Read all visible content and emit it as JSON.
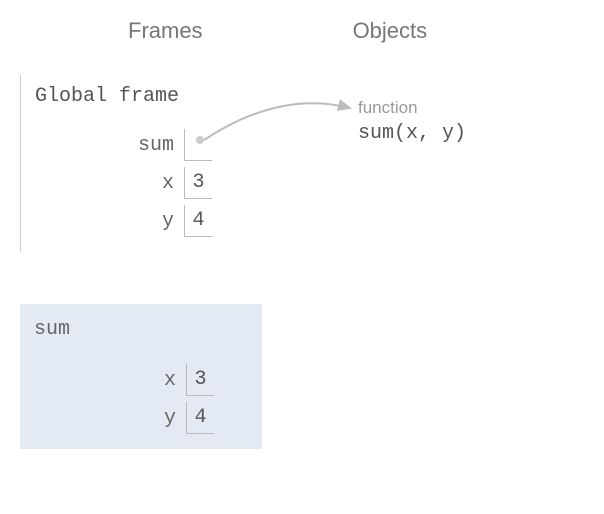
{
  "headers": {
    "frames": "Frames",
    "objects": "Objects"
  },
  "global_frame": {
    "title": "Global frame",
    "vars": [
      {
        "name": "sum",
        "value": ""
      },
      {
        "name": "x",
        "value": "3"
      },
      {
        "name": "y",
        "value": "4"
      }
    ]
  },
  "local_frame": {
    "title": "sum",
    "vars": [
      {
        "name": "x",
        "value": "3"
      },
      {
        "name": "y",
        "value": "4"
      }
    ]
  },
  "object": {
    "label": "function",
    "signature": "sum(x, y)"
  }
}
